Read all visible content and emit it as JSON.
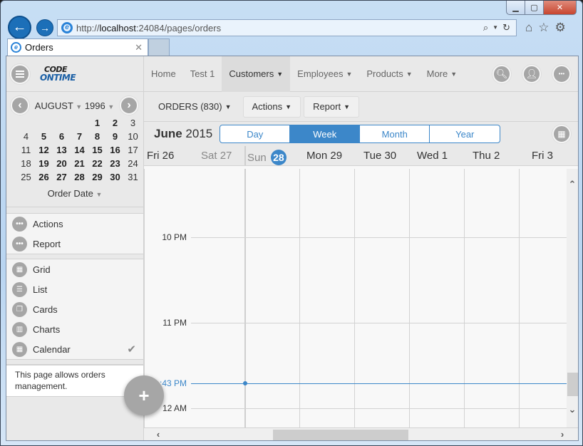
{
  "browser": {
    "url_prefix": "http://",
    "url_host": "localhost",
    "url_rest": ":24084/pages/orders",
    "tab_title": "Orders",
    "icons": [
      "back-icon",
      "forward-icon",
      "search-icon",
      "refresh-icon",
      "home-icon",
      "favorites-icon",
      "settings-icon"
    ]
  },
  "app": {
    "logo_line1": "CODE",
    "logo_line2": "ONTIME",
    "nav": [
      {
        "label": "Home",
        "dropdown": false
      },
      {
        "label": "Test 1",
        "dropdown": false
      },
      {
        "label": "Customers",
        "dropdown": true,
        "active": true
      },
      {
        "label": "Employees",
        "dropdown": true
      },
      {
        "label": "Products",
        "dropdown": true
      },
      {
        "label": "More",
        "dropdown": true
      }
    ]
  },
  "mini_calendar": {
    "month": "AUGUST",
    "year": "1996",
    "weeks": [
      [
        {
          "d": ""
        },
        {
          "d": ""
        },
        {
          "d": ""
        },
        {
          "d": ""
        },
        {
          "d": "1",
          "b": true
        },
        {
          "d": "2",
          "b": true
        },
        {
          "d": "3"
        }
      ],
      [
        {
          "d": "4"
        },
        {
          "d": "5",
          "b": true
        },
        {
          "d": "6",
          "b": true
        },
        {
          "d": "7",
          "b": true
        },
        {
          "d": "8",
          "b": true
        },
        {
          "d": "9",
          "b": true
        },
        {
          "d": "10"
        }
      ],
      [
        {
          "d": "11"
        },
        {
          "d": "12",
          "b": true
        },
        {
          "d": "13",
          "b": true
        },
        {
          "d": "14",
          "b": true
        },
        {
          "d": "15",
          "b": true
        },
        {
          "d": "16",
          "b": true
        },
        {
          "d": "17"
        }
      ],
      [
        {
          "d": "18"
        },
        {
          "d": "19",
          "b": true
        },
        {
          "d": "20",
          "b": true
        },
        {
          "d": "21",
          "b": true
        },
        {
          "d": "22",
          "b": true
        },
        {
          "d": "23",
          "b": true
        },
        {
          "d": "24"
        }
      ],
      [
        {
          "d": "25"
        },
        {
          "d": "26",
          "b": true
        },
        {
          "d": "27",
          "b": true
        },
        {
          "d": "28",
          "b": true
        },
        {
          "d": "29",
          "b": true
        },
        {
          "d": "30",
          "b": true
        },
        {
          "d": "31"
        }
      ]
    ],
    "field": "Order Date"
  },
  "sidebar": {
    "actions": [
      {
        "label": "Actions",
        "icon": "more-icon"
      },
      {
        "label": "Report",
        "icon": "more-icon"
      }
    ],
    "views": [
      {
        "label": "Grid",
        "icon": "grid-icon"
      },
      {
        "label": "List",
        "icon": "list-icon"
      },
      {
        "label": "Cards",
        "icon": "cards-icon"
      },
      {
        "label": "Charts",
        "icon": "charts-icon"
      },
      {
        "label": "Calendar",
        "icon": "calendar-icon",
        "selected": true
      }
    ],
    "description": "This page allows orders management."
  },
  "toolbar": {
    "orders_label": "ORDERS (830)",
    "actions_label": "Actions",
    "report_label": "Report"
  },
  "calendar": {
    "month": "June",
    "year": "2015",
    "views": [
      "Day",
      "Week",
      "Month",
      "Year"
    ],
    "selected_view": "Week",
    "days": [
      {
        "name": "Fri",
        "num": "26",
        "dim": false
      },
      {
        "name": "Sat",
        "num": "27",
        "dim": true
      },
      {
        "name": "Sun",
        "num": "28",
        "today": true
      },
      {
        "name": "Mon",
        "num": "29"
      },
      {
        "name": "Tue",
        "num": "30"
      },
      {
        "name": "Wed",
        "num": "1"
      },
      {
        "name": "Thu",
        "num": "2"
      },
      {
        "name": "Fri",
        "num": "3"
      }
    ],
    "time_labels": [
      "10 PM",
      "11 PM",
      "12 AM"
    ],
    "current_time_label": ":43 PM",
    "accent_color": "#3c87c9"
  }
}
